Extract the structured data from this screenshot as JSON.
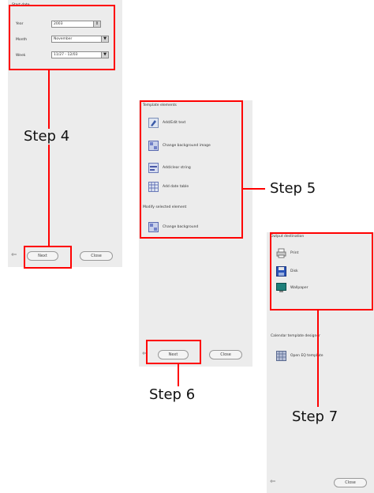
{
  "panel1": {
    "section_title": "Start date",
    "fields": [
      {
        "label": "Year",
        "value": "2003"
      },
      {
        "label": "Month",
        "value": "November"
      },
      {
        "label": "Week",
        "value": "11/27 - 12/03"
      }
    ],
    "next_label": "Next",
    "close_label": "Close"
  },
  "panel2": {
    "section1_title": "Template elements",
    "items1": [
      "Add/Edit text",
      "Change background image",
      "Add/clear string",
      "Add date table"
    ],
    "section2_title": "Modify selected element",
    "items2": [
      "Change background"
    ],
    "next_label": "Next",
    "close_label": "Close"
  },
  "panel3": {
    "section1_title": "Output destination",
    "items1": [
      "Print",
      "Disk",
      "Wallpaper"
    ],
    "section2_title": "Calendar template designer",
    "items2": [
      "Open EQ template"
    ],
    "close_label": "Close"
  },
  "steps": {
    "step4": "Step 4",
    "step5": "Step 5",
    "step6": "Step 6",
    "step7": "Step 7"
  },
  "colors": {
    "highlight": "#ff0000",
    "panel_bg": "#ececec"
  },
  "icons": [
    "text-edit-icon",
    "background-image-icon",
    "string-icon",
    "date-table-icon",
    "change-background-icon",
    "printer-icon",
    "disk-icon",
    "wallpaper-icon",
    "template-icon"
  ]
}
